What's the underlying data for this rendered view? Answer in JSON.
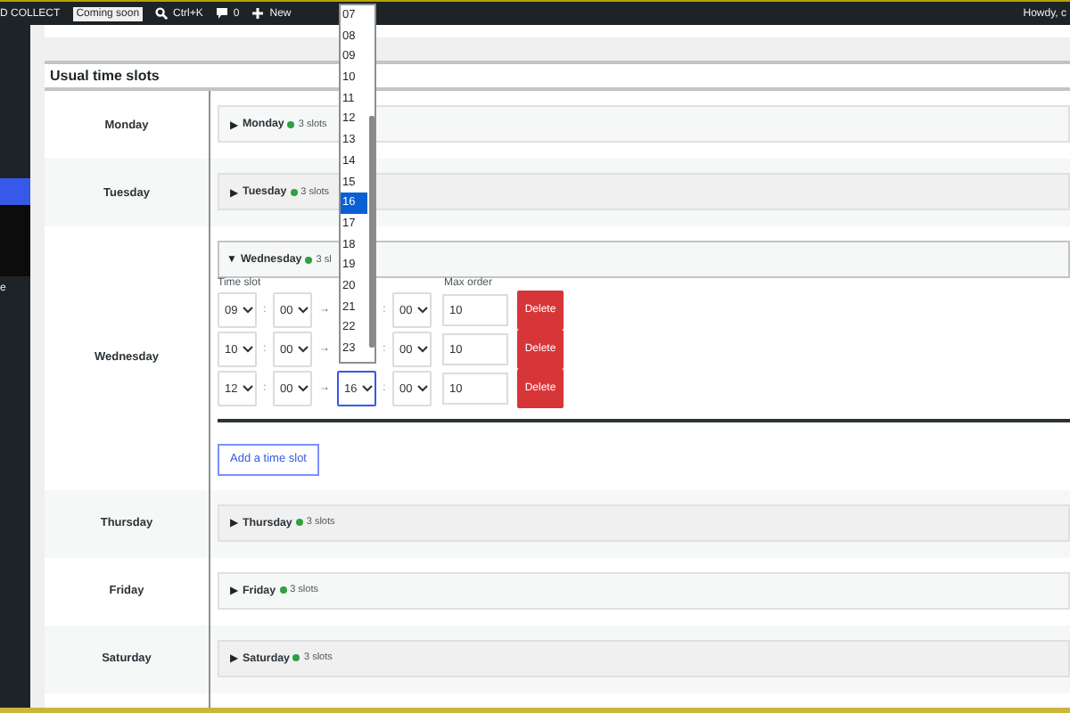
{
  "admin_bar": {
    "site_name": "D COLLECT",
    "badge": "Coming soon",
    "search_shortcut": "Ctrl+K",
    "comments": "0",
    "new_label": "New",
    "greeting": "Howdy, c"
  },
  "sidebar": {
    "items": [
      {
        "selected": true
      },
      {
        "label": "e",
        "selected": false
      }
    ]
  },
  "section": {
    "title": "Usual time slots",
    "days": [
      {
        "name": "Monday",
        "expanded": false,
        "summary": {
          "toggle": "▶",
          "label": "Monday",
          "color": "#2ea043",
          "count": "3 slots"
        }
      },
      {
        "name": "Tuesday",
        "expanded": false,
        "summary": {
          "toggle": "▶",
          "label": "Tuesday",
          "color": "#2ea043",
          "count": "3 slots"
        }
      },
      {
        "name": "Wednesday",
        "expanded": true,
        "summary": {
          "toggle": "▼",
          "label": "Wednesday",
          "color": "#2ea043",
          "count": "3 sl"
        },
        "time_slot_label": "Time slot",
        "max_order_label": "Max order",
        "slots": [
          {
            "start_hour": "09",
            "start_separator": ":",
            "start_minute": "00",
            "range_arrow": "→",
            "end_separator": ":",
            "end_minute": "00",
            "max_order": "10",
            "delete": "Delete",
            "focused": false
          },
          {
            "start_hour": "10",
            "start_separator": ":",
            "start_minute": "00",
            "range_arrow": "→",
            "end_separator": ":",
            "end_minute": "00",
            "max_order": "10",
            "delete": "Delete",
            "focused": false
          },
          {
            "start_hour": "12",
            "start_separator": ":",
            "start_minute": "00",
            "range_arrow": "→",
            "end_hour": "16",
            "end_separator": ":",
            "end_minute": "00",
            "max_order": "10",
            "delete": "Delete",
            "focused": true
          }
        ],
        "add_button": "Add a time slot"
      },
      {
        "name": "Thursday",
        "expanded": false,
        "summary": {
          "toggle": "▶",
          "label": "Thursday",
          "color": "#2ea043",
          "count": "3 slots"
        }
      },
      {
        "name": "Friday",
        "expanded": false,
        "summary": {
          "toggle": "▶",
          "label": "Friday",
          "color": "#2ea043",
          "count": "3 slots"
        }
      },
      {
        "name": "Saturday",
        "expanded": false,
        "summary": {
          "toggle": "▶",
          "label": "Saturday",
          "color": "#2ea043",
          "count": "3 slots"
        }
      }
    ]
  },
  "hour_dropdown": {
    "options": [
      {
        "label": "07",
        "selected": false
      },
      {
        "label": "08",
        "selected": false
      },
      {
        "label": "09",
        "selected": false
      },
      {
        "label": "10",
        "selected": false
      },
      {
        "label": "11",
        "selected": false
      },
      {
        "label": "12",
        "selected": false
      },
      {
        "label": "13",
        "selected": false
      },
      {
        "label": "14",
        "selected": false
      },
      {
        "label": "15",
        "selected": false
      },
      {
        "label": "16",
        "selected": true
      },
      {
        "label": "17",
        "selected": false
      },
      {
        "label": "18",
        "selected": false
      },
      {
        "label": "19",
        "selected": false
      },
      {
        "label": "20",
        "selected": false
      },
      {
        "label": "21",
        "selected": false
      },
      {
        "label": "22",
        "selected": false
      },
      {
        "label": "23",
        "selected": false
      }
    ]
  }
}
